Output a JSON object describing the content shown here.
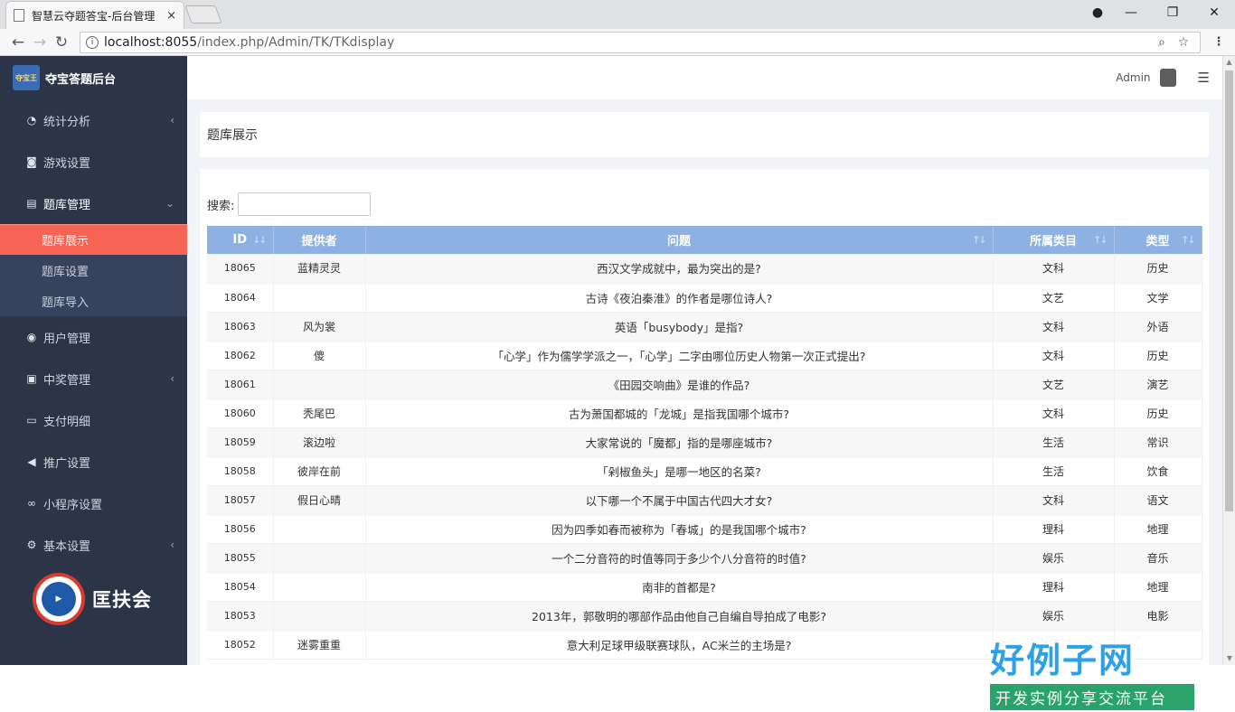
{
  "browser": {
    "tab_title": "智慧云夺题答宝-后台管理",
    "tab_close": "×",
    "url_host": "localhost:8055",
    "url_path": "/index.php/Admin/TK/TKdisplay"
  },
  "app": {
    "brand": "夺宝答题后台",
    "brand_logo_text": "夺宝王",
    "user": "Admin",
    "footer_logo_text": "匡扶会"
  },
  "sidebar": {
    "items": [
      {
        "label": "统计分析",
        "icon": "pie-chart-icon",
        "arrow": "‹"
      },
      {
        "label": "游戏设置",
        "icon": "gamepad-icon",
        "arrow": ""
      },
      {
        "label": "题库管理",
        "icon": "list-icon",
        "arrow": "⌄"
      },
      {
        "label": "用户管理",
        "icon": "user-icon",
        "arrow": ""
      },
      {
        "label": "中奖管理",
        "icon": "badge-icon",
        "arrow": "‹"
      },
      {
        "label": "支付明细",
        "icon": "card-icon",
        "arrow": ""
      },
      {
        "label": "推广设置",
        "icon": "megaphone-icon",
        "arrow": ""
      },
      {
        "label": "小程序设置",
        "icon": "link-icon",
        "arrow": ""
      },
      {
        "label": "基本设置",
        "icon": "gear-icon",
        "arrow": "‹"
      }
    ],
    "sub_items": [
      "题库展示",
      "题库设置",
      "题库导入"
    ]
  },
  "page": {
    "title": "题库展示",
    "search_label": "搜索:",
    "search_value": ""
  },
  "table": {
    "columns": [
      "ID",
      "提供者",
      "问题",
      "所属类目",
      "类型"
    ],
    "rows": [
      [
        "18065",
        "蓝精灵灵",
        "西汉文学成就中，最为突出的是?",
        "文科",
        "历史"
      ],
      [
        "18064",
        "",
        "古诗《夜泊秦淮》的作者是哪位诗人?",
        "文艺",
        "文学"
      ],
      [
        "18063",
        "风为裳",
        "英语「busybody」是指?",
        "文科",
        "外语"
      ],
      [
        "18062",
        "傻",
        "「心学」作为儒学学派之一，「心学」二字由哪位历史人物第一次正式提出?",
        "文科",
        "历史"
      ],
      [
        "18061",
        "",
        "《田园交响曲》是谁的作品?",
        "文艺",
        "演艺"
      ],
      [
        "18060",
        "秃尾巴",
        "古为萧国都城的「龙城」是指我国哪个城市?",
        "文科",
        "历史"
      ],
      [
        "18059",
        "滚边啦",
        "大家常说的「魔都」指的是哪座城市?",
        "生活",
        "常识"
      ],
      [
        "18058",
        "彼岸在前",
        "「剁椒鱼头」是哪一地区的名菜?",
        "生活",
        "饮食"
      ],
      [
        "18057",
        "假日心晴",
        "以下哪一个不属于中国古代四大才女?",
        "文科",
        "语文"
      ],
      [
        "18056",
        "",
        "因为四季如春而被称为「春城」的是我国哪个城市?",
        "理科",
        "地理"
      ],
      [
        "18055",
        "",
        "一个二分音符的时值等同于多少个八分音符的时值?",
        "娱乐",
        "音乐"
      ],
      [
        "18054",
        "",
        "南非的首都是?",
        "理科",
        "地理"
      ],
      [
        "18053",
        "",
        "2013年，郭敬明的哪部作品由他自己自编自导拍成了电影?",
        "娱乐",
        "电影"
      ],
      [
        "18052",
        "迷雾重重",
        "意大利足球甲级联赛球队，AC米兰的主场是?",
        "",
        ""
      ]
    ]
  },
  "watermark": {
    "brand_big": "好例子网",
    "brand_small": "开发实例分享交流平台"
  }
}
